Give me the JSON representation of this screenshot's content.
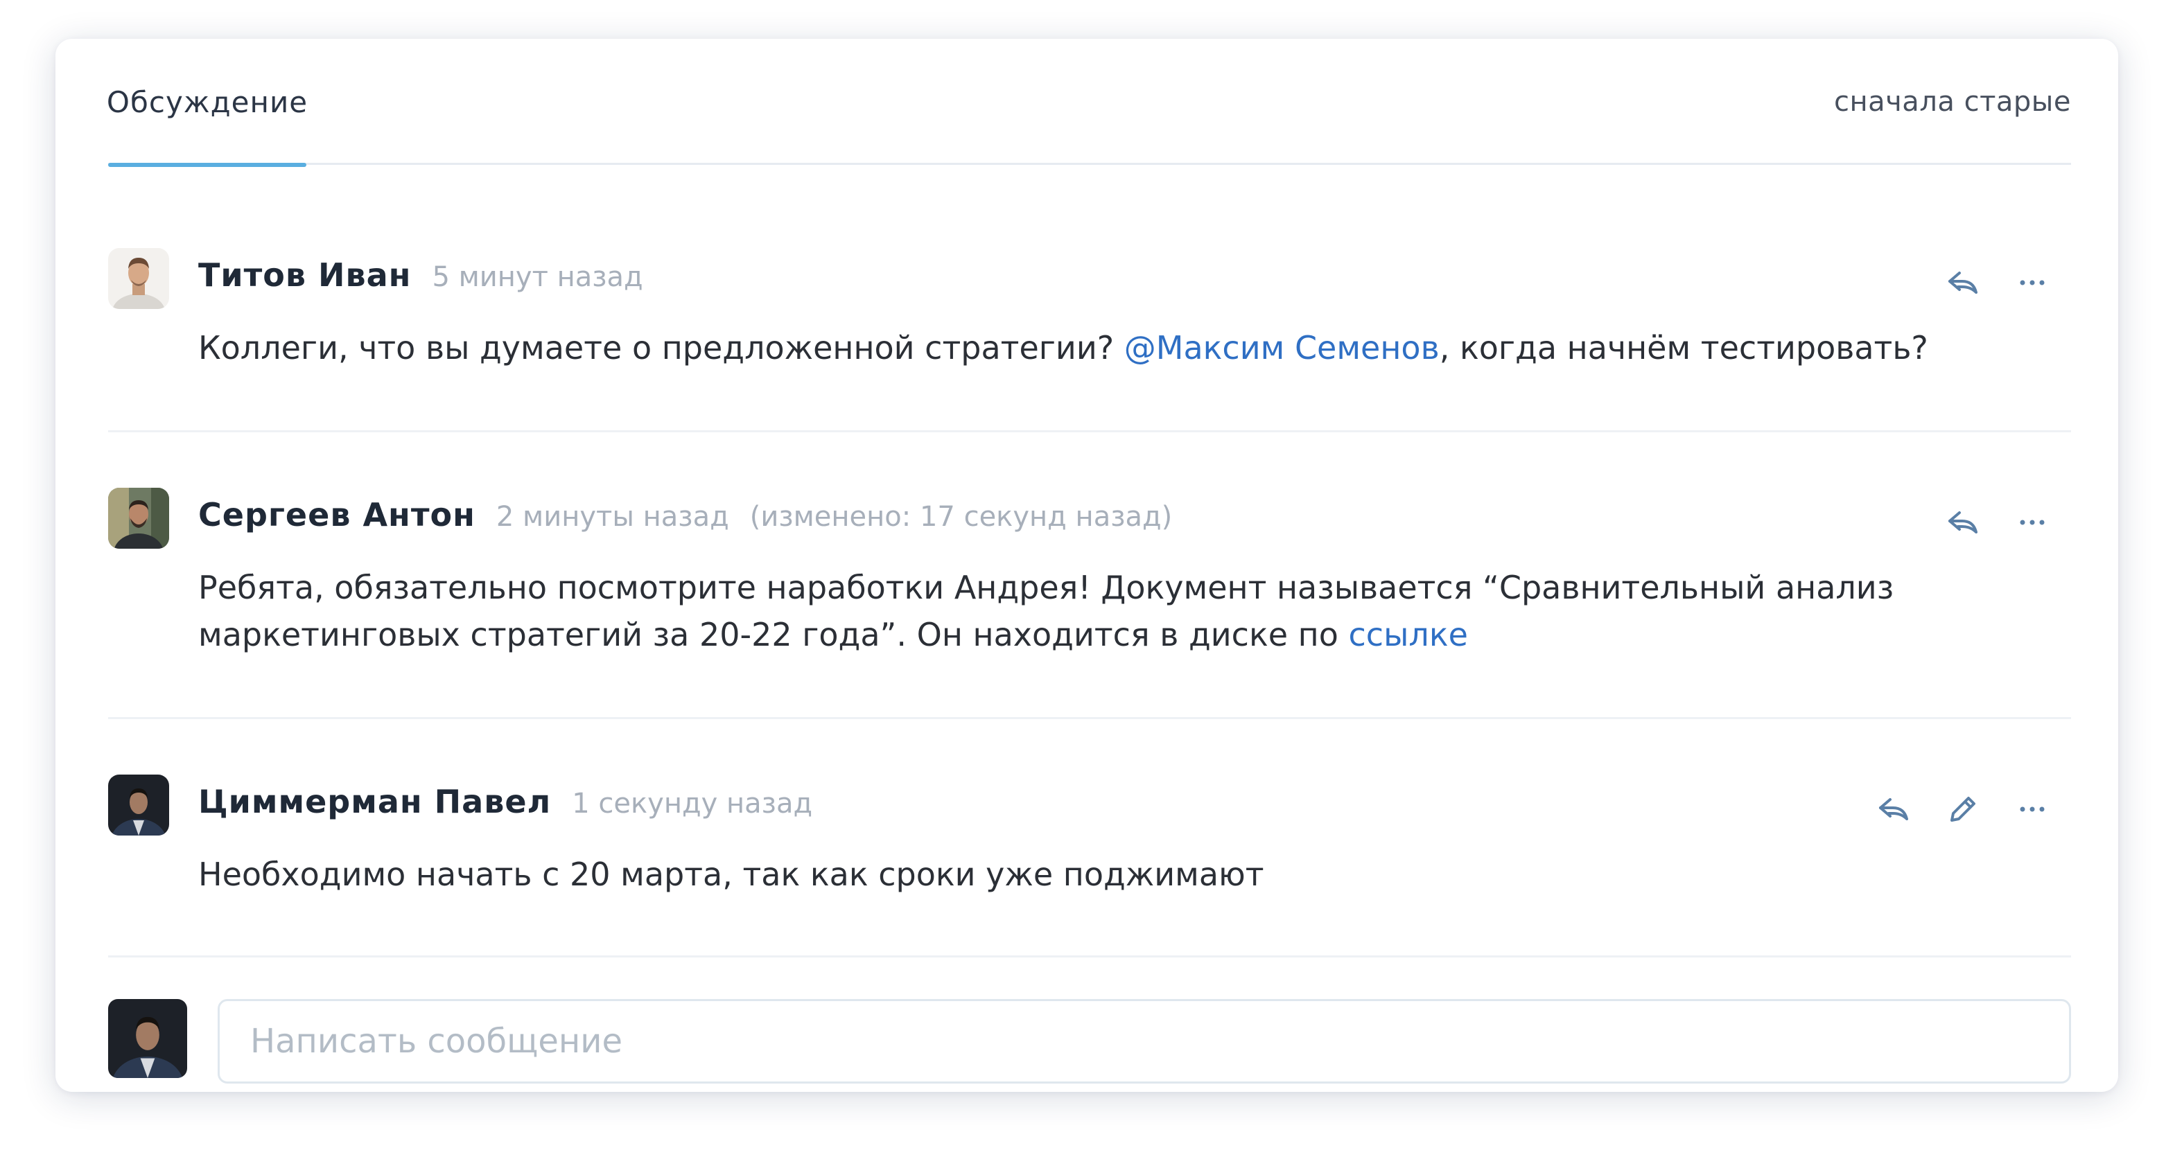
{
  "header": {
    "tab_label": "Обсуждение",
    "sort_label": "сначала старые",
    "accent_color": "#5aaee0"
  },
  "comments": [
    {
      "author": "Титов Иван",
      "time": "5 минут назад",
      "text_before": "Коллеги, что вы думаете о предложенной стратегии? ",
      "mention": "@Максим Семенов",
      "text_after": ", когда начнём тестировать?",
      "actions": [
        "reply-icon",
        "more-icon"
      ]
    },
    {
      "author": "Сергеев Антон",
      "time": "2 минуты назад",
      "edited": "(изменено: 17 секунд назад)",
      "text_before": "Ребята, обязательно посмотрите наработки Андрея! Документ называется “Сравнительный анализ маркетинговых стратегий за 20-22 года”. Он находится в диске по ",
      "link": "ссылке",
      "actions": [
        "reply-icon",
        "more-icon"
      ]
    },
    {
      "author": "Циммерман Павел",
      "time": "1 секунду назад",
      "text": "Необходимо начать с 20 марта, так как сроки уже поджимают",
      "actions": [
        "reply-icon",
        "edit-icon",
        "more-icon"
      ]
    }
  ],
  "composer": {
    "placeholder": "Написать сообщение"
  },
  "colors": {
    "link": "#2f6fc4",
    "muted": "#a7afba",
    "icon": "#5a7fa6"
  }
}
